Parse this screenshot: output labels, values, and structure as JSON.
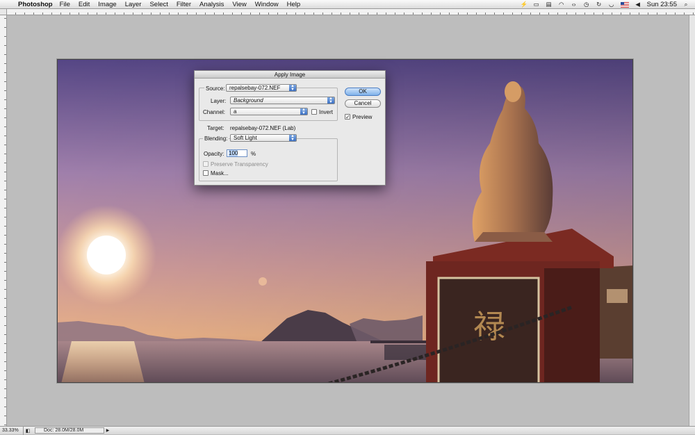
{
  "menubar": {
    "apple": "",
    "app": "Photoshop",
    "menus": [
      "File",
      "Edit",
      "Image",
      "Layer",
      "Select",
      "Filter",
      "Analysis",
      "View",
      "Window",
      "Help"
    ],
    "clock": "Sun 23:55"
  },
  "statusbar": {
    "zoom": "33.33%",
    "doc": "Doc: 28.0M/28.0M"
  },
  "dialog": {
    "title": "Apply Image",
    "source_label": "Source:",
    "source_value": "repalsebay-072.NEF",
    "layer_label": "Layer:",
    "layer_value": "Background",
    "channel_label": "Channel:",
    "channel_value": "a",
    "invert_label": "Invert",
    "target_label": "Target:",
    "target_value": "repalsebay-072.NEF (Lab)",
    "blending_label": "Blending:",
    "blending_value": "Soft Light",
    "opacity_label": "Opacity:",
    "opacity_value": "100",
    "opacity_unit": "%",
    "preserve_label": "Preserve Transparency",
    "mask_label": "Mask...",
    "ok_label": "OK",
    "cancel_label": "Cancel",
    "preview_label": "Preview",
    "invert_checked": false,
    "preview_checked": true,
    "preserve_checked": false,
    "mask_checked": false
  }
}
